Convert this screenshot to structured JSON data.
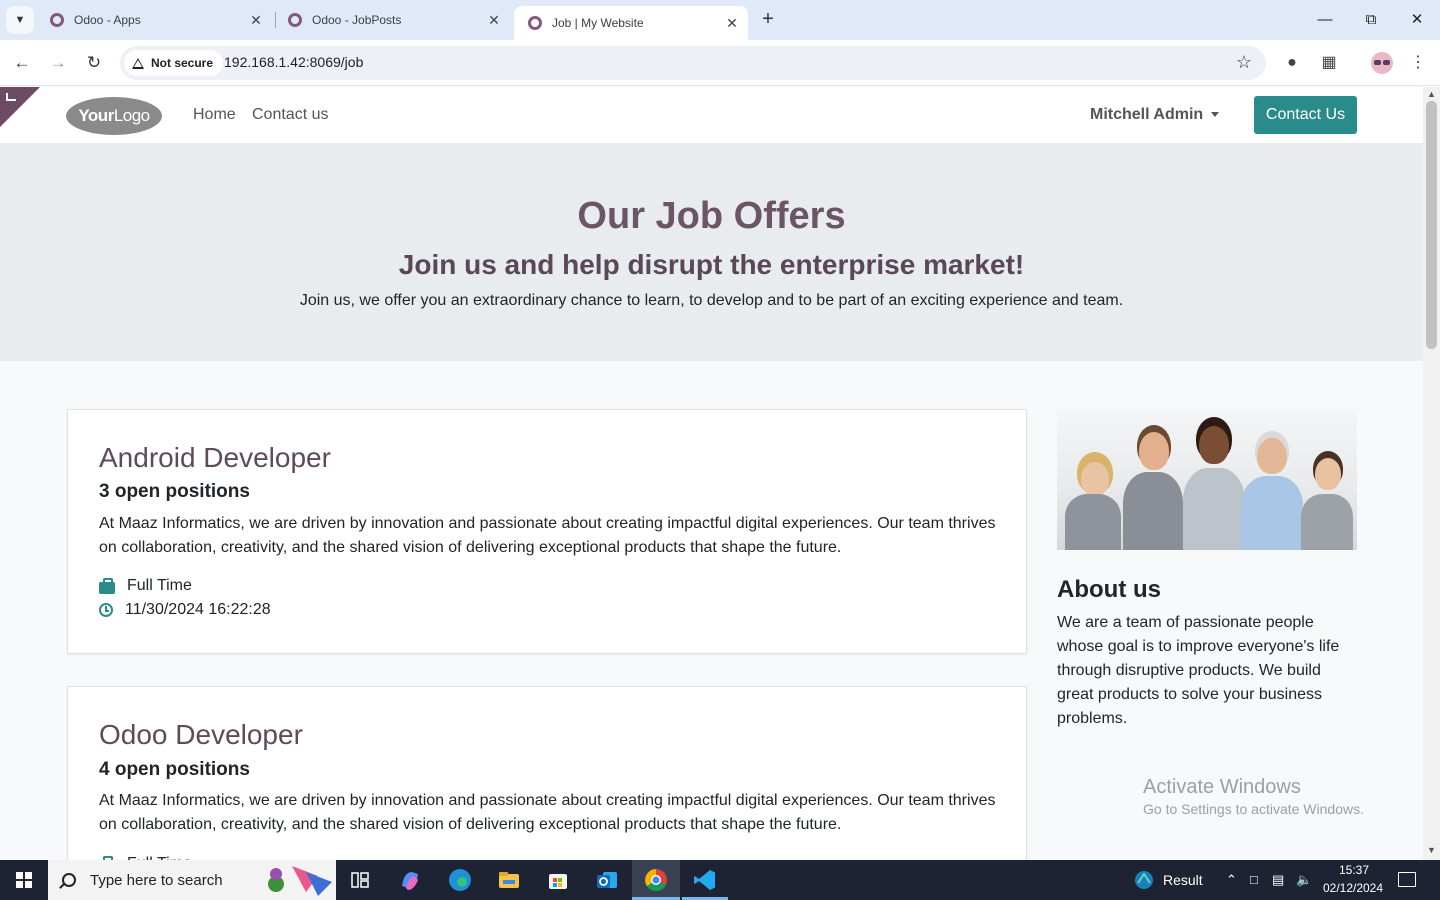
{
  "browser": {
    "tabs": [
      {
        "title": "Odoo - Apps",
        "active": false
      },
      {
        "title": "Odoo - JobPosts",
        "active": false
      },
      {
        "title": "Job | My Website",
        "active": true
      }
    ],
    "security_label": "Not secure",
    "url": "192.168.1.42:8069/job"
  },
  "site": {
    "logo_text_bold": "Your",
    "logo_text_light": "Logo",
    "nav": {
      "home": "Home",
      "contact": "Contact us"
    },
    "user": "Mitchell Admin",
    "cta": "Contact Us",
    "accent_color": "#2a8b8b",
    "brand_color": "#6b5666"
  },
  "hero": {
    "title": "Our Job Offers",
    "subtitle": "Join us and help disrupt the enterprise market!",
    "text": "Join us, we offer you an extraordinary chance to learn, to develop and to be part of an exciting experience and team."
  },
  "jobs": [
    {
      "title": "Android Developer",
      "openings": "3 open positions",
      "description": "At Maaz Informatics, we are driven by innovation and passionate about creating impactful digital experiences. Our team thrives on collaboration, creativity, and the shared vision of delivering exceptional products that shape the future.",
      "type": "Full Time",
      "date": "11/30/2024 16:22:28"
    },
    {
      "title": "Odoo Developer",
      "openings": "4 open positions",
      "description": "At Maaz Informatics, we are driven by innovation and passionate about creating impactful digital experiences. Our team thrives on collaboration, creativity, and the shared vision of delivering exceptional products that shape the future.",
      "type": "Full Time"
    }
  ],
  "about": {
    "title": "About us",
    "text": "We are a team of passionate people whose goal is to improve everyone's life through disruptive products. We build great products to solve your business problems."
  },
  "watermark": {
    "line1": "Activate Windows",
    "line2": "Go to Settings to activate Windows."
  },
  "taskbar": {
    "search_placeholder": "Type here to search",
    "weather_label": "Result",
    "time": "15:37",
    "date": "02/12/2024"
  }
}
